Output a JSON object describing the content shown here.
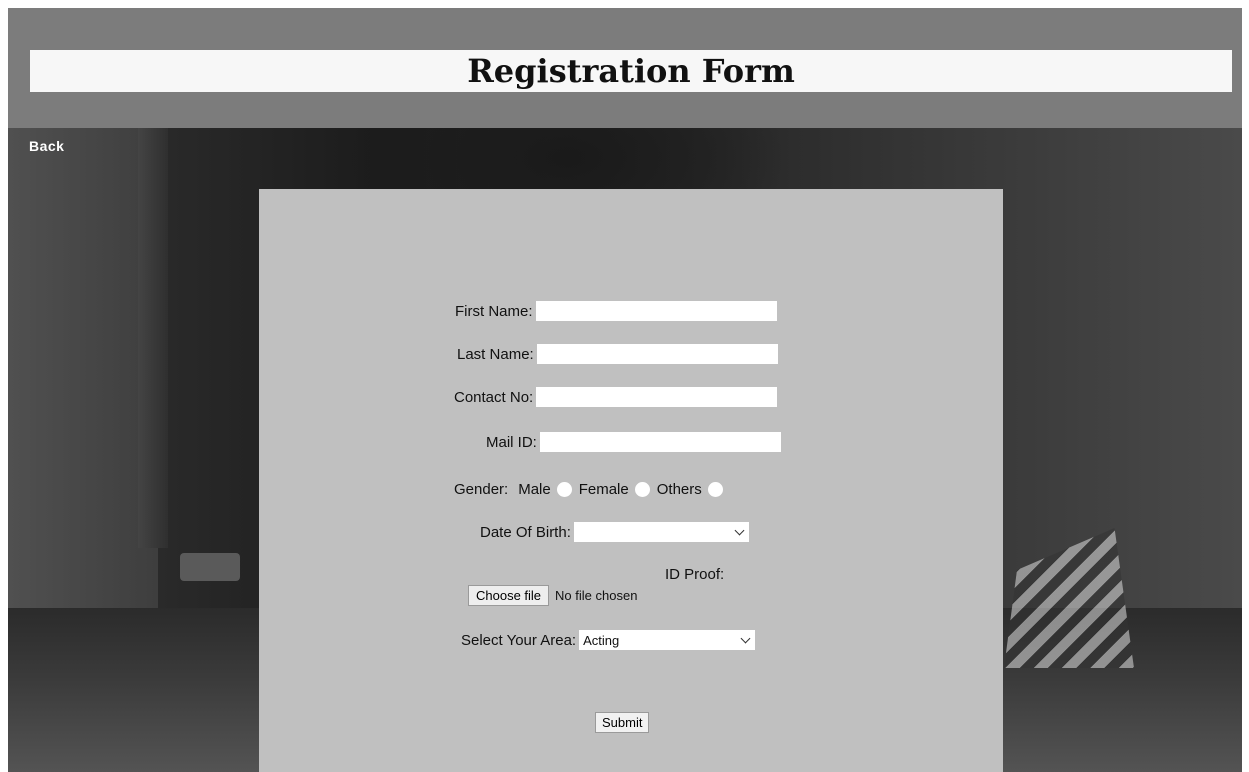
{
  "header": {
    "title": "Registration Form"
  },
  "nav": {
    "back_label": "Back"
  },
  "form": {
    "first_name": {
      "label": "First Name:",
      "value": ""
    },
    "last_name": {
      "label": "Last Name:",
      "value": ""
    },
    "contact": {
      "label": "Contact No:",
      "value": ""
    },
    "mail": {
      "label": "Mail ID:",
      "value": ""
    },
    "gender": {
      "label": "Gender:",
      "options": [
        "Male",
        "Female",
        "Others"
      ]
    },
    "dob": {
      "label": "Date Of Birth:",
      "value": ""
    },
    "id_proof": {
      "label": "ID Proof:",
      "button_label": "Choose file",
      "status": "No file chosen"
    },
    "area": {
      "label": "Select Your Area:",
      "value": "Acting"
    },
    "submit_label": "Submit"
  }
}
